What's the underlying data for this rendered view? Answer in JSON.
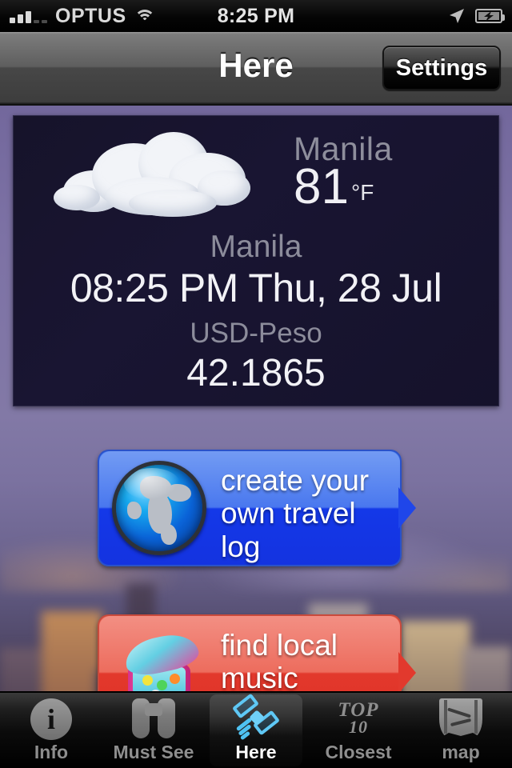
{
  "status_bar": {
    "carrier": "OPTUS",
    "time": "8:25 PM",
    "signal_icon": "signal-bars-icon",
    "wifi_icon": "wifi-icon",
    "location_icon": "location-arrow-icon",
    "battery_icon": "battery-charging-icon"
  },
  "nav_bar": {
    "title": "Here",
    "settings_label": "Settings"
  },
  "info_panel": {
    "weather": {
      "icon": "cloud-icon",
      "city": "Manila",
      "temperature": "81",
      "unit": "°F"
    },
    "timezone": {
      "city": "Manila",
      "datetime": "08:25 PM Thu, 28 Jul"
    },
    "currency": {
      "label": "USD-Peso",
      "rate": "42.1865"
    }
  },
  "promos": [
    {
      "id": "travel-log",
      "icon": "globe-icon",
      "line1": "create your",
      "line2": "own travel log",
      "color": "#1f46ea"
    },
    {
      "id": "music-events",
      "icon": "bin-icon",
      "line1": "find local",
      "line2": "music events",
      "color": "#e2392d"
    }
  ],
  "tab_bar": {
    "items": [
      {
        "label": "Info",
        "icon": "info-circle-icon",
        "active": false
      },
      {
        "label": "Must See",
        "icon": "binoculars-icon",
        "active": false
      },
      {
        "label": "Here",
        "icon": "satellite-icon",
        "active": true
      },
      {
        "label": "Closest",
        "icon": "top-10-icon",
        "active": false
      },
      {
        "label": "map",
        "icon": "map-icon",
        "active": false
      }
    ],
    "top10_icon_text": {
      "top": "TOP",
      "number": "10"
    }
  }
}
